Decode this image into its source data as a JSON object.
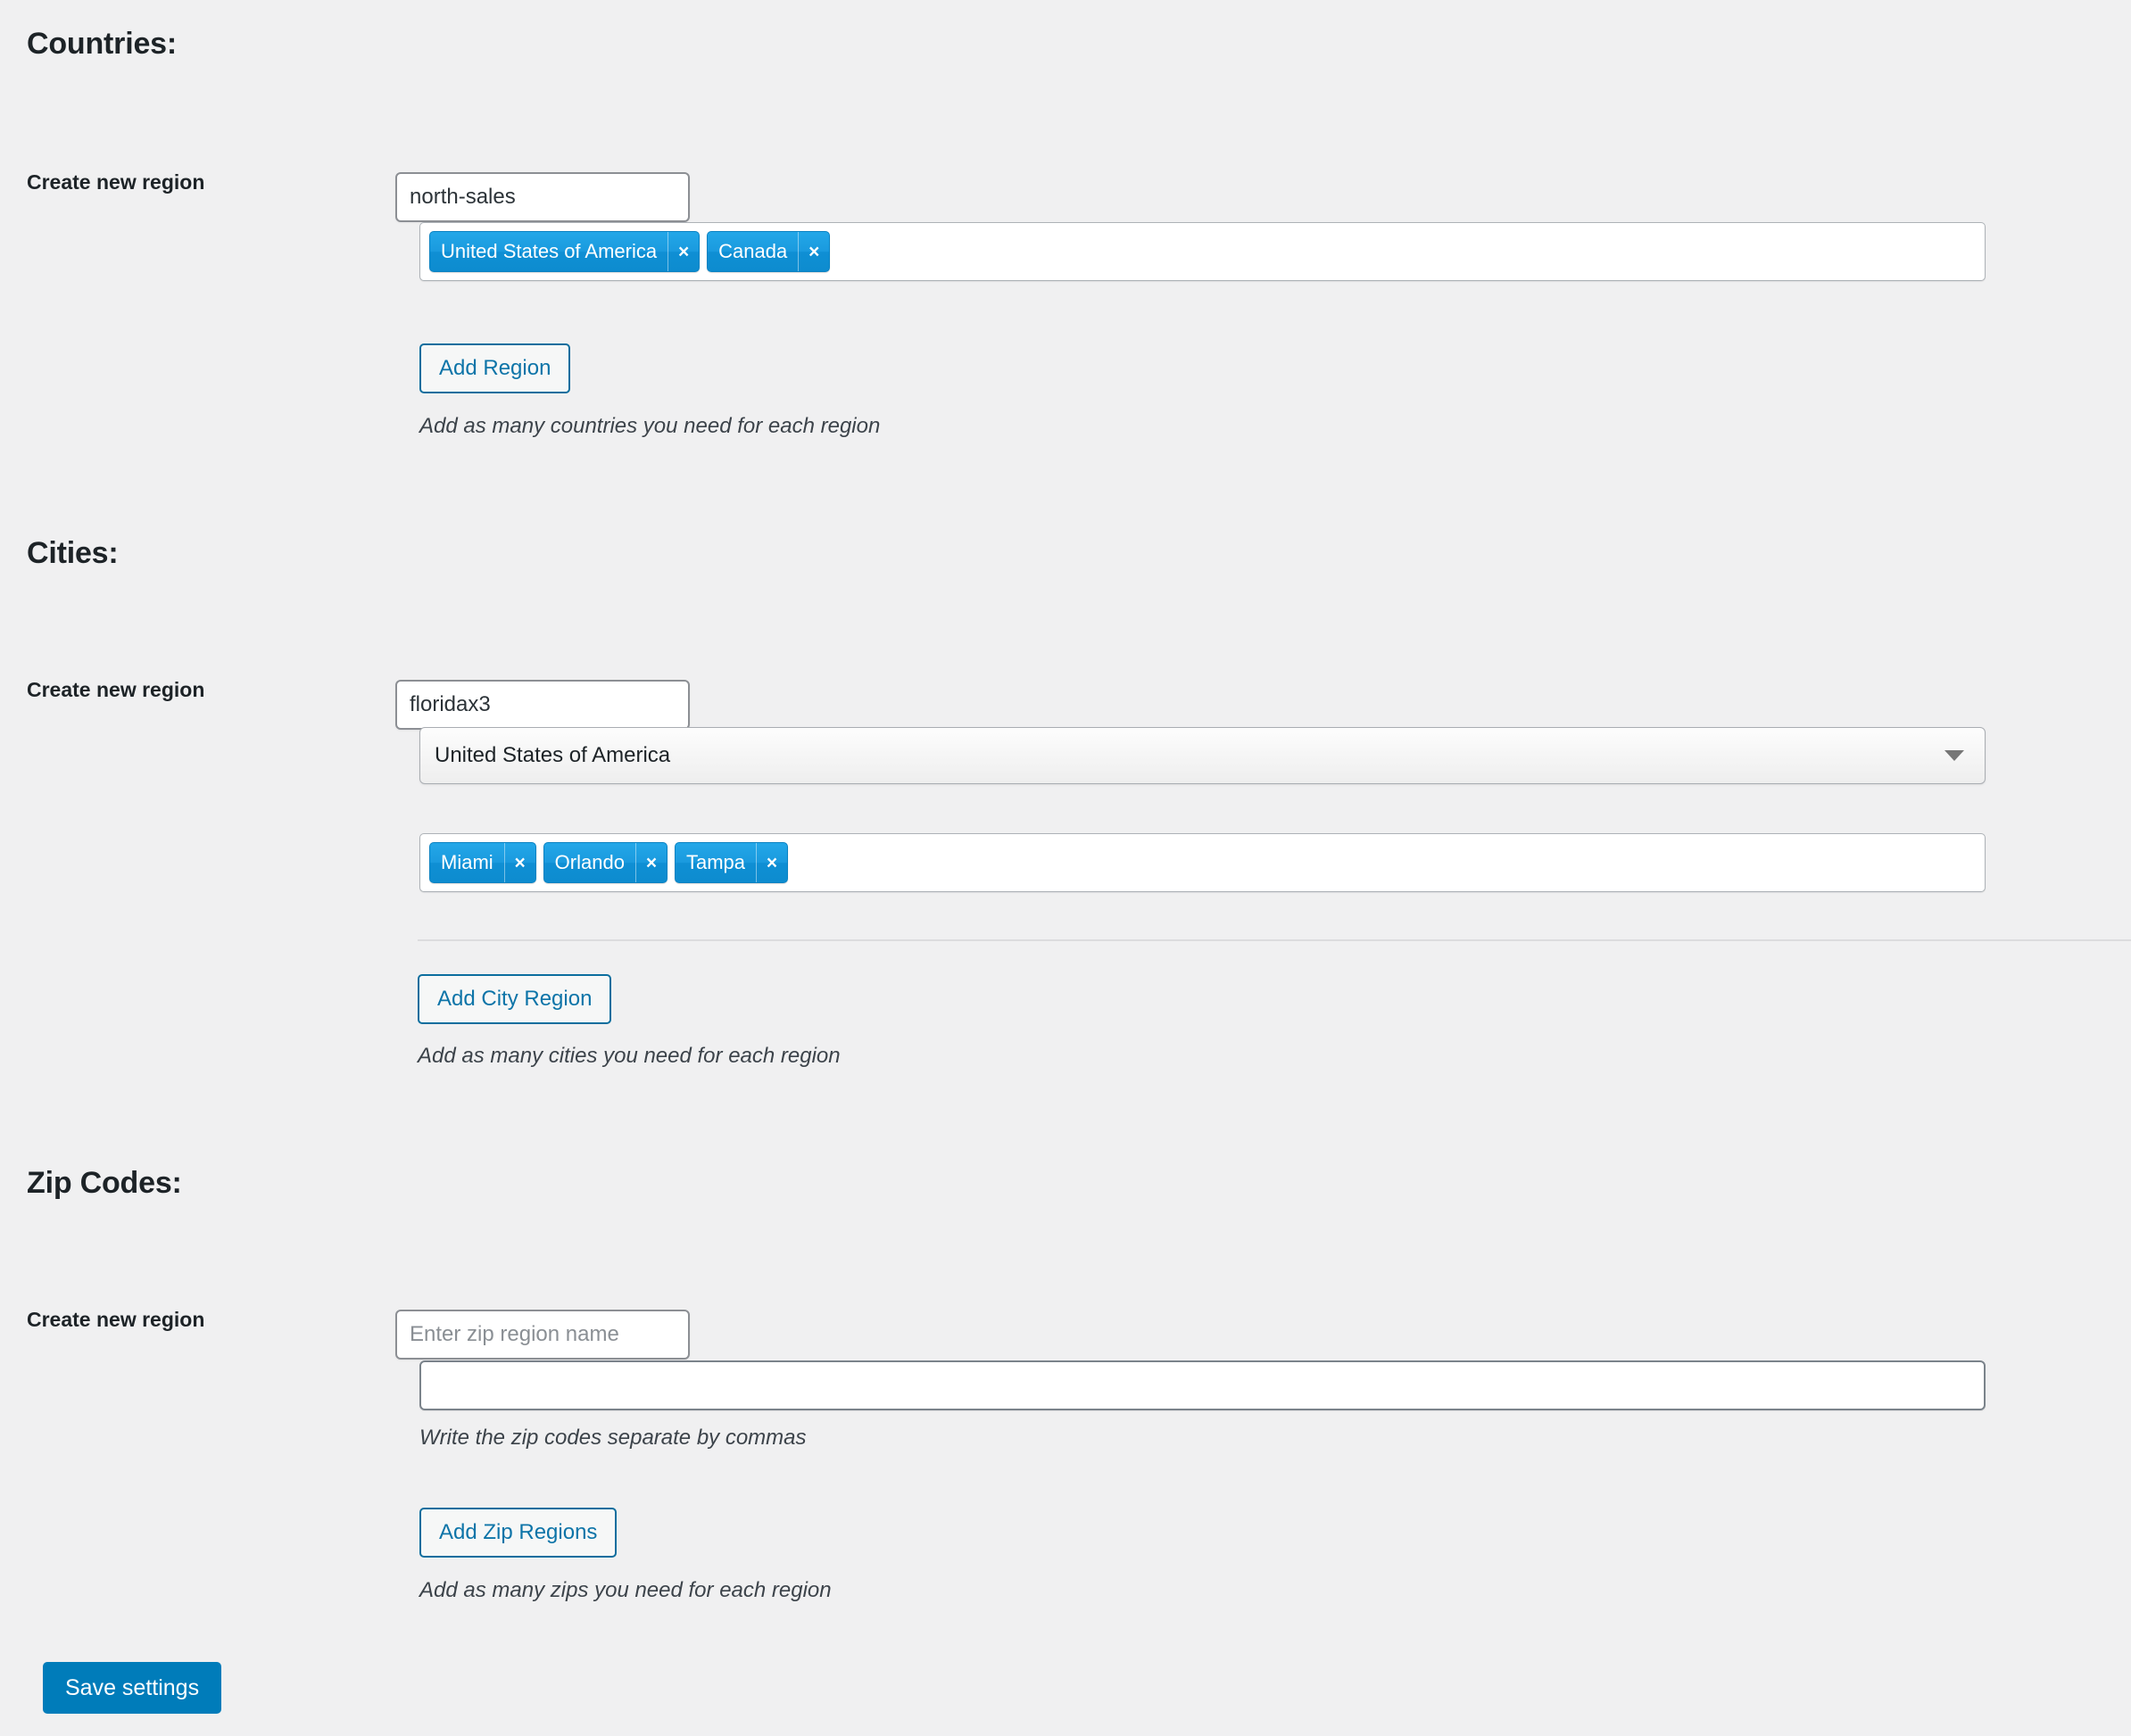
{
  "sections": [
    {
      "id": "countries",
      "title": "Countries:",
      "label": "Create new region",
      "region_name_value": "north-sales",
      "region_name_placeholder": "",
      "tags": [
        {
          "label": "United States of America",
          "remove": "×"
        },
        {
          "label": "Canada",
          "remove": "×"
        }
      ],
      "button": "Add Region",
      "hint": "Add as many countries you need for each region"
    },
    {
      "id": "cities",
      "title": "Cities:",
      "label": "Create new region",
      "region_name_value": "floridax3",
      "region_name_placeholder": "",
      "country_select_value": "United States of America",
      "tags": [
        {
          "label": "Miami",
          "remove": "×"
        },
        {
          "label": "Orlando",
          "remove": "×"
        },
        {
          "label": "Tampa",
          "remove": "×"
        }
      ],
      "button": "Add City Region",
      "hint": "Add as many cities you need for each region"
    },
    {
      "id": "zipcodes",
      "title": "Zip Codes:",
      "label": "Create new region",
      "region_name_value": "",
      "region_name_placeholder": "Enter zip region name",
      "zip_codes_value": "",
      "zip_codes_placeholder": "",
      "zip_hint": "Write the zip codes separate by commas",
      "button": "Add Zip Regions",
      "hint": "Add as many zips you need for each region"
    }
  ],
  "footer": {
    "save_label": "Save settings"
  },
  "colors": {
    "page_bg": "#f0f0f1",
    "tag_blue": "#1a9ade",
    "primary_blue": "#007cba",
    "outline_blue": "#0b6e9e",
    "text": "#1d2327"
  },
  "icons": {
    "select_chevron": "chevron-down-icon",
    "tag_remove": "close-icon"
  }
}
